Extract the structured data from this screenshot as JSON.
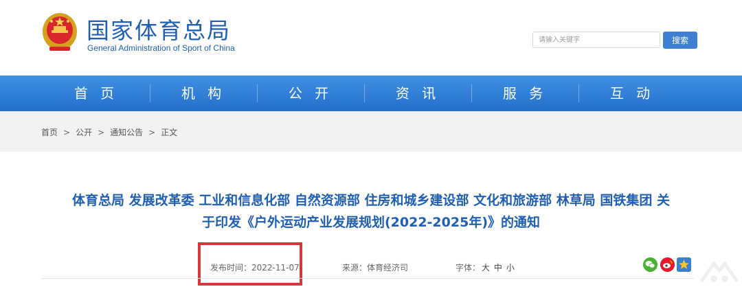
{
  "header": {
    "site_title": "国家体育总局",
    "site_subtitle": "General Administration of Sport of China",
    "search_placeholder": "请输入关键字",
    "search_button": "搜索"
  },
  "nav": {
    "items": [
      "首 页",
      "机 构",
      "公 开",
      "资 讯",
      "服 务",
      "互 动"
    ]
  },
  "breadcrumb": {
    "items": [
      "首页",
      "公开",
      "通知公告",
      "正文"
    ],
    "separator": ">"
  },
  "article": {
    "title_line1": "体育总局 发展改革委 工业和信息化部 自然资源部 住房和城乡建设部 文化和旅游部 林草局 国铁集团 关",
    "title_line2": "于印发《户外运动产业发展规划(2022-2025年)》的通知",
    "publish_label": "发布时间：",
    "publish_date": "2022-11-07",
    "source_label": "来源：",
    "source_value": "体育经济司",
    "font_label": "字体：",
    "font_sizes": [
      "大",
      "中",
      "小"
    ]
  },
  "colors": {
    "brand_blue": "#1f5fb3",
    "nav_blue": "#2f7ed8",
    "highlight_red": "#d7363c"
  },
  "icons": [
    "national-emblem-icon",
    "wechat-share-icon",
    "weibo-share-icon",
    "qzone-share-icon"
  ]
}
